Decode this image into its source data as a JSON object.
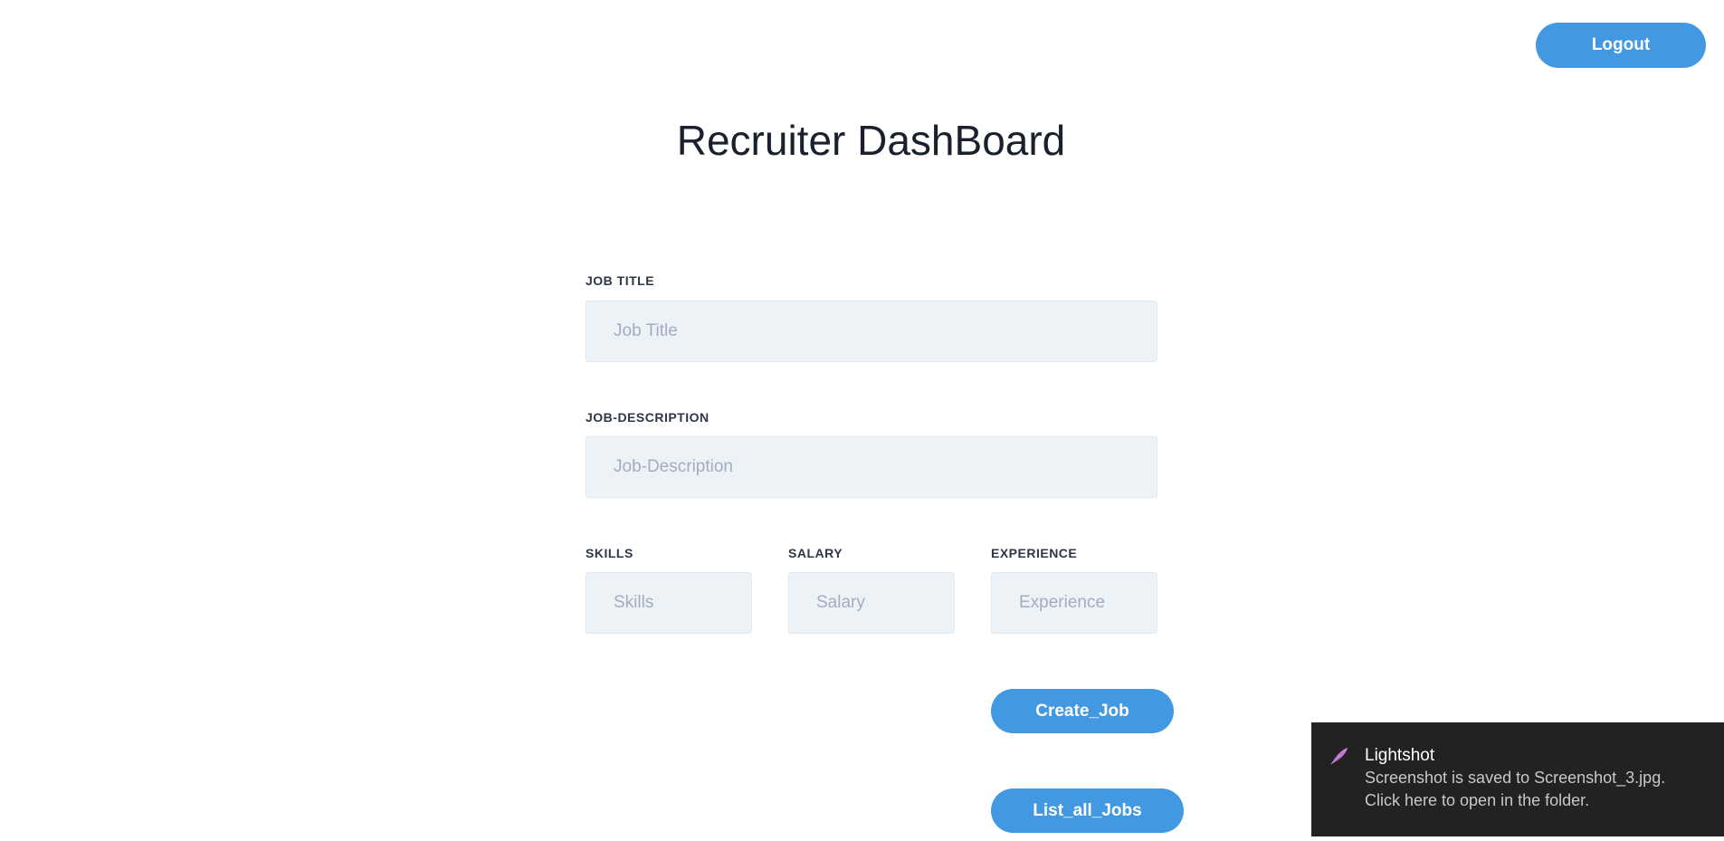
{
  "header": {
    "logout_label": "Logout",
    "title": "Recruiter DashBoard"
  },
  "form": {
    "job_title": {
      "label": "JOB TITLE",
      "placeholder": "Job Title",
      "value": ""
    },
    "job_description": {
      "label": "JOB-DESCRIPTION",
      "placeholder": "Job-Description",
      "value": ""
    },
    "skills": {
      "label": "SKILLS",
      "placeholder": "Skills",
      "value": ""
    },
    "salary": {
      "label": "SALARY",
      "placeholder": "Salary",
      "value": ""
    },
    "experience": {
      "label": "EXPERIENCE",
      "placeholder": "Experience",
      "value": ""
    }
  },
  "actions": {
    "create_job_label": "Create_Job",
    "list_all_jobs_label": "List_all_Jobs"
  },
  "notification": {
    "app_name": "Lightshot",
    "message_line1": "Screenshot is saved to Screenshot_3.jpg.",
    "message_line2": "Click here to open in the folder.",
    "icon": "lightshot-feather-icon"
  },
  "colors": {
    "accent": "#4299e1",
    "input_bg": "#edf2f7",
    "toast_bg": "#222222"
  }
}
